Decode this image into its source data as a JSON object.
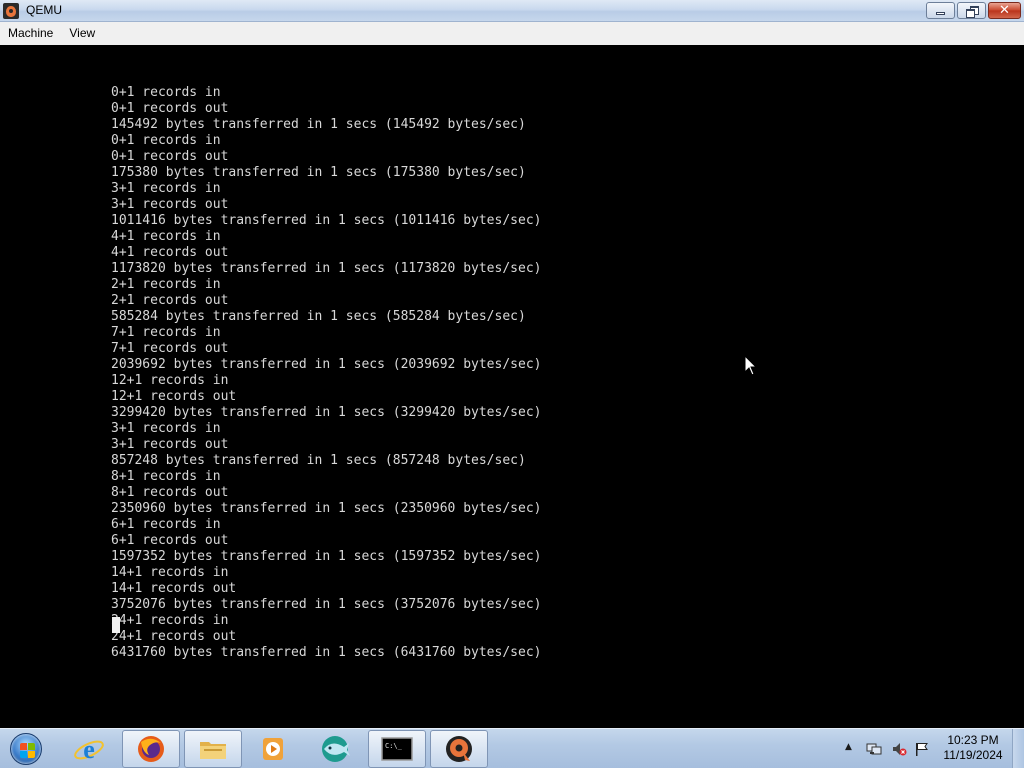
{
  "window": {
    "title": "QEMU",
    "controls": {
      "minimize": "minimize",
      "maximize": "restore",
      "close": "close"
    }
  },
  "menu": [
    "Machine",
    "View"
  ],
  "console": {
    "lines": [
      "0+1 records in",
      "0+1 records out",
      "145492 bytes transferred in 1 secs (145492 bytes/sec)",
      "0+1 records in",
      "0+1 records out",
      "175380 bytes transferred in 1 secs (175380 bytes/sec)",
      "3+1 records in",
      "3+1 records out",
      "1011416 bytes transferred in 1 secs (1011416 bytes/sec)",
      "4+1 records in",
      "4+1 records out",
      "1173820 bytes transferred in 1 secs (1173820 bytes/sec)",
      "2+1 records in",
      "2+1 records out",
      "585284 bytes transferred in 1 secs (585284 bytes/sec)",
      "7+1 records in",
      "7+1 records out",
      "2039692 bytes transferred in 1 secs (2039692 bytes/sec)",
      "12+1 records in",
      "12+1 records out",
      "3299420 bytes transferred in 1 secs (3299420 bytes/sec)",
      "3+1 records in",
      "3+1 records out",
      "857248 bytes transferred in 1 secs (857248 bytes/sec)",
      "8+1 records in",
      "8+1 records out",
      "2350960 bytes transferred in 1 secs (2350960 bytes/sec)",
      "6+1 records in",
      "6+1 records out",
      "1597352 bytes transferred in 1 secs (1597352 bytes/sec)",
      "14+1 records in",
      "14+1 records out",
      "3752076 bytes transferred in 1 secs (3752076 bytes/sec)",
      "24+1 records in",
      "24+1 records out",
      "6431760 bytes transferred in 1 secs (6431760 bytes/sec)"
    ],
    "colors": {
      "background": "#000000",
      "foreground": "#d8d8d8"
    }
  },
  "taskbar": {
    "items": [
      {
        "icon": "internet-explorer-icon",
        "active": false
      },
      {
        "icon": "firefox-icon",
        "active": true
      },
      {
        "icon": "file-explorer-icon",
        "active": true
      },
      {
        "icon": "media-player-icon",
        "active": false
      },
      {
        "icon": "bluefish-icon",
        "active": false
      },
      {
        "icon": "command-prompt-icon",
        "active": true
      },
      {
        "icon": "qemu-icon",
        "active": true
      }
    ],
    "cmd_icon_text": "C:\\_"
  },
  "tray": {
    "icons": [
      "show-hidden-icons-arrow",
      "network-icon",
      "volume-muted-icon",
      "action-center-flag-icon"
    ],
    "time": "10:23 PM",
    "date": "11/19/2024"
  }
}
